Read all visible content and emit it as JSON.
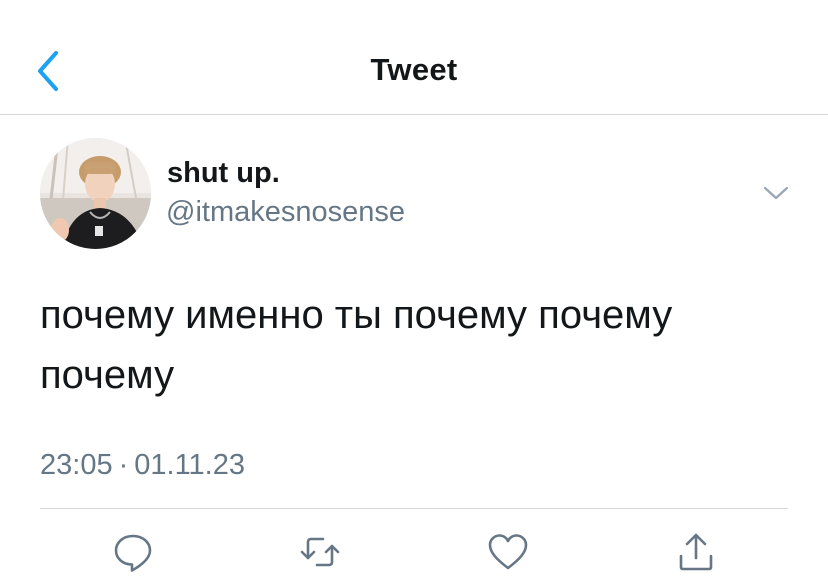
{
  "header": {
    "title": "Tweet",
    "back_icon": "chevron-left-icon"
  },
  "author": {
    "display_name": "shut up.",
    "handle": "@itmakesnosense",
    "avatar_icon": "profile-photo"
  },
  "tweet": {
    "text": "почему именно ты почему почему почему",
    "time": "23:05",
    "separator": "·",
    "date": "01.11.23",
    "more_icon": "chevron-down-icon"
  },
  "actions": {
    "reply_icon": "reply-icon",
    "retweet_icon": "retweet-icon",
    "like_icon": "heart-icon",
    "share_icon": "share-icon"
  },
  "colors": {
    "accent": "#1DA1F2",
    "text": "#14171A",
    "secondary": "#657786",
    "divider": "#D6D9DC"
  }
}
